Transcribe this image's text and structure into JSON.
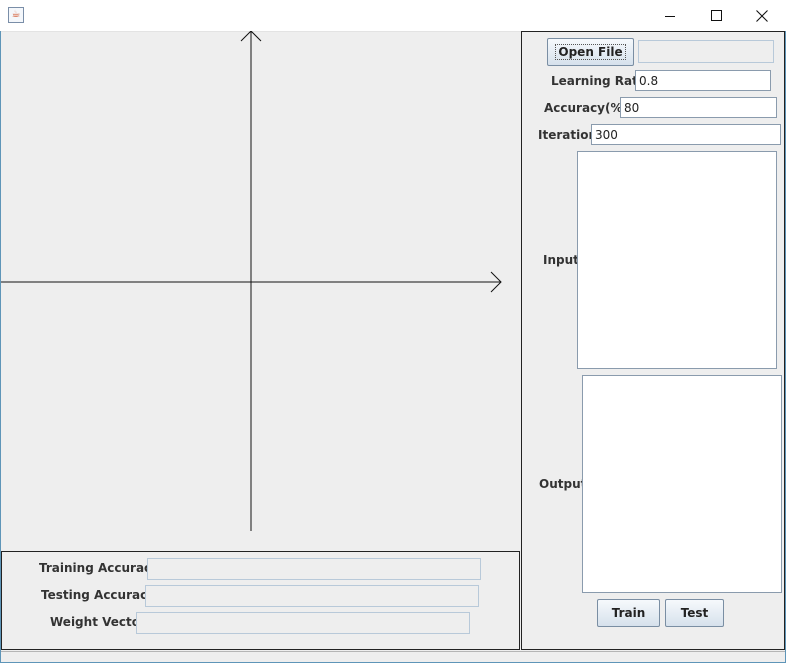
{
  "window": {
    "app_icon": "java-cup-icon",
    "controls": {
      "minimize": "minimize-icon",
      "maximize": "maximize-icon",
      "close": "close-icon"
    }
  },
  "plot": {
    "x_axis": "arrow-right",
    "y_axis": "arrow-up"
  },
  "results": {
    "training_accuracy": {
      "label": "Training Accuracy",
      "value": ""
    },
    "testing_accuracy": {
      "label": "Testing Accuracy",
      "value": ""
    },
    "weight_vector": {
      "label": "Weight Vector",
      "value": ""
    }
  },
  "controls": {
    "open_file": {
      "label": "Open File",
      "path": ""
    },
    "learning_rate": {
      "label": "Learning Rate",
      "value": "0.8"
    },
    "accuracy": {
      "label": "Accuracy(%)",
      "value": "80"
    },
    "iteration": {
      "label": "Iteration",
      "value": "300"
    },
    "input": {
      "label": "Input",
      "value": ""
    },
    "output": {
      "label": "Output",
      "value": ""
    },
    "train": {
      "label": "Train"
    },
    "test": {
      "label": "Test"
    }
  },
  "colors": {
    "background": "#eeeeee",
    "border": "#222222",
    "window_border": "#5e95b8"
  }
}
